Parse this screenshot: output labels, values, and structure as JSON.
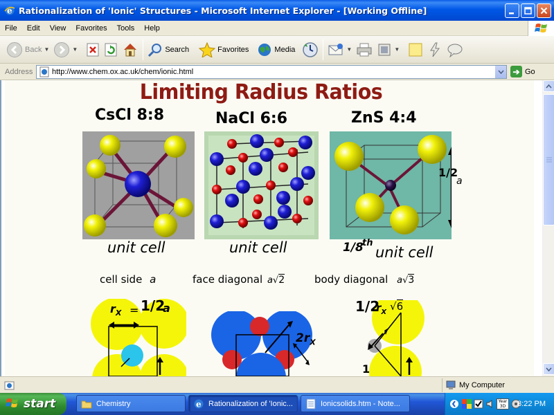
{
  "window": {
    "title": "Rationalization of 'Ionic' Structures - Microsoft Internet Explorer - [Working Offline]"
  },
  "menu": [
    "File",
    "Edit",
    "View",
    "Favorites",
    "Tools",
    "Help"
  ],
  "toolbar": {
    "back": "Back",
    "search": "Search",
    "favorites": "Favorites",
    "media": "Media"
  },
  "address": {
    "label": "Address",
    "url": "http://www.chem.ox.ac.uk/chem/ionic.html",
    "go": "Go"
  },
  "page": {
    "heading": "Limiting Radius Ratios",
    "structures": [
      {
        "title": "CsCl 8:8",
        "caption": "unit cell",
        "dimension": "cell side"
      },
      {
        "title": "NaCl 6:6",
        "caption": "unit cell",
        "dimension": "face diagonal"
      },
      {
        "title": "ZnS 4:4",
        "caption": "unit cell",
        "caption_fraction": "1/8",
        "caption_th": "th",
        "dimension": "body diagonal"
      }
    ],
    "labels": {
      "a": "a",
      "sqrt2": "2",
      "sqrt3": "3",
      "half": "1/2",
      "rx": "r",
      "x_sub": "X",
      "equals": "=",
      "two": "2",
      "one": "1",
      "six": "6"
    }
  },
  "statusbar": {
    "zone": "My Computer"
  },
  "taskbar": {
    "start": "start",
    "tasks": [
      "Chemistry",
      "Rationalization of 'Ionic...",
      "Ionicsolids.htm - Note..."
    ],
    "time": "8:22 PM",
    "tray_badge": "Year 3D"
  },
  "colors": {
    "heading": "#8e1b13",
    "anion_yellow": "#f2f20a",
    "cation_blue": "#1f1fd6",
    "bond": "#6b1538",
    "nacl_red": "#e01010",
    "nacl_blue_cap": "#1a64e6"
  }
}
